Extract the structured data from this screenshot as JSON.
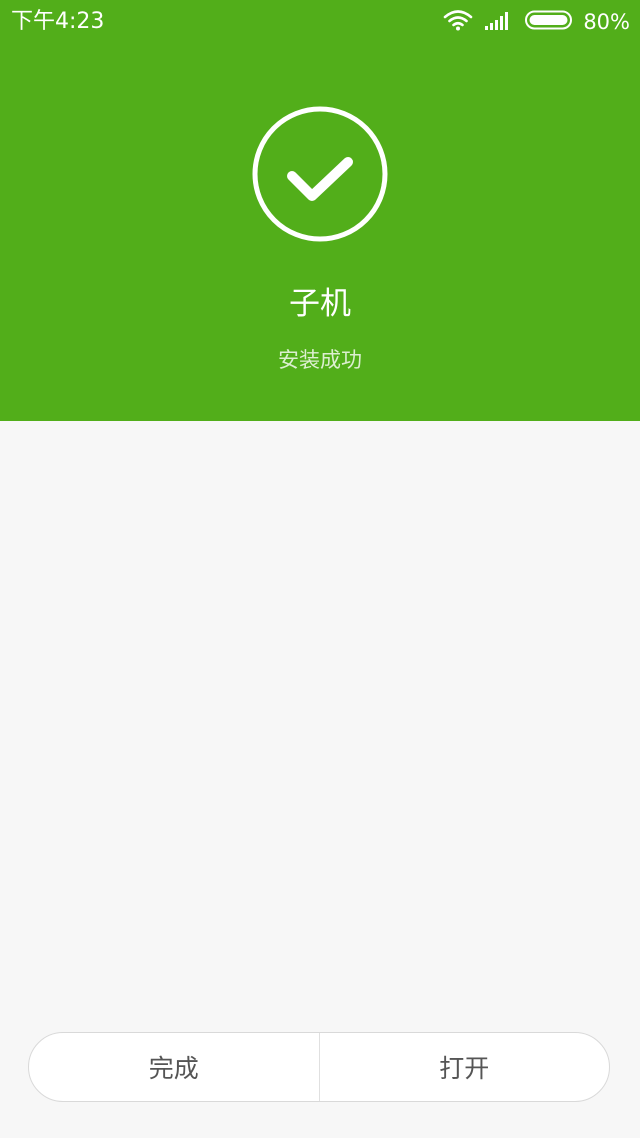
{
  "status_bar": {
    "time": "下午4:23",
    "battery_percent": "80%",
    "icons": [
      "wifi-icon",
      "signal-icon",
      "battery-icon"
    ]
  },
  "result": {
    "icon": "check-circle-icon",
    "app_name": "子机",
    "status": "安装成功"
  },
  "actions": {
    "done_label": "完成",
    "open_label": "打开"
  },
  "colors": {
    "header_green": "#52ae1a",
    "page_background": "#f7f7f7",
    "button_text": "#555555"
  }
}
